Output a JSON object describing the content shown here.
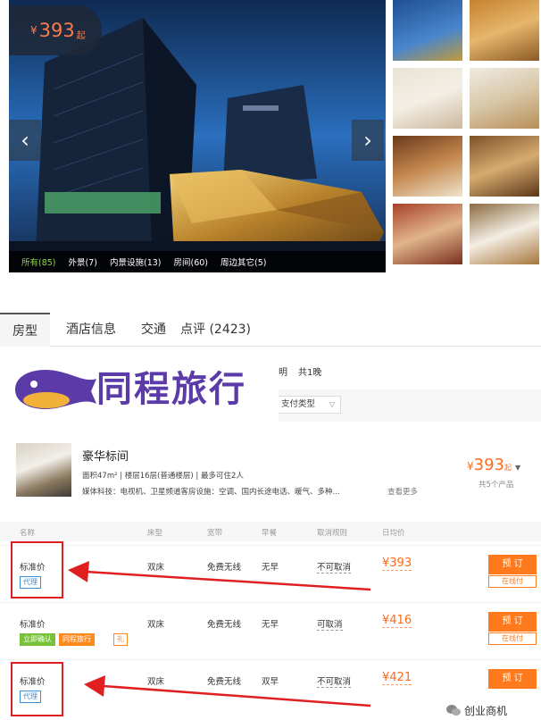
{
  "gallery": {
    "price_currency": "¥",
    "price_value": "393",
    "price_suffix": "起",
    "prev_arrow": "‹",
    "next_arrow": "›",
    "photo_tabs": [
      "所有(85)",
      "外景(7)",
      "内景设施(13)",
      "房间(60)",
      "周边其它(5)"
    ]
  },
  "nav": {
    "tabs": [
      "房型",
      "酒店信息",
      "交通",
      "点评 (2423)"
    ]
  },
  "logo": {
    "text": "同程旅行",
    "brand_color": "#5b3ba8"
  },
  "filter": {
    "date_tail": "明",
    "nights": "共1晚",
    "pay_type_label": "支付类型",
    "caret": "▽"
  },
  "room": {
    "name": "豪华标间",
    "specs": "面积47m² | 楼层16层(普通楼层) | 最多可住2人",
    "amenities": "媒体科技：电视机、卫星频道客房设施：空调、国内长途电话、暖气、多种...",
    "view_more": "查看更多",
    "price_currency": "¥",
    "price_value": "393",
    "price_suffix": "起",
    "price_caret": "▼",
    "product_count": "共5个产品"
  },
  "table": {
    "headers": [
      "名称",
      "床型",
      "宽带",
      "早餐",
      "取消规则",
      "日均价"
    ],
    "rows": [
      {
        "name": "标准价",
        "tags": [
          "代理"
        ],
        "bed": "双床",
        "wifi": "免费无线",
        "meal": "无早",
        "cancel": "不可取消",
        "price": "¥393",
        "book": "预 订",
        "pay": "在线付"
      },
      {
        "name": "标准价",
        "tags": [
          "立即确认",
          "同程旅行",
          "礼"
        ],
        "bed": "双床",
        "wifi": "免费无线",
        "meal": "无早",
        "cancel": "可取消",
        "price": "¥416",
        "book": "预 订",
        "pay": "在线付"
      },
      {
        "name": "标准价",
        "tags": [
          "代理"
        ],
        "bed": "双床",
        "wifi": "免费无线",
        "meal": "双早",
        "cancel": "不可取消",
        "price": "¥421",
        "book": "预 订",
        "pay": ""
      }
    ]
  },
  "watermark": {
    "text": "创业商机"
  },
  "colors": {
    "accent": "#ff7a1c",
    "annotation_red": "#e02020",
    "tag_blue": "#3a8ed6",
    "tag_green": "#78c23a"
  }
}
